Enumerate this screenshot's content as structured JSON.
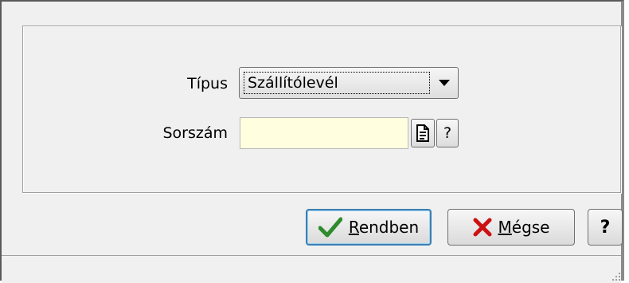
{
  "form": {
    "type_label": "Típus",
    "type_value": "Szállítólevél",
    "serial_label": "Sorszám",
    "serial_value": "",
    "serial_help": "?"
  },
  "buttons": {
    "ok_pre": "",
    "ok_mnemonic": "R",
    "ok_rest": "endben",
    "cancel_mnemonic": "M",
    "cancel_rest": "égse",
    "help": "?"
  },
  "colors": {
    "input_bg": "#ffffe0",
    "ok_border": "#3c7fb1",
    "check_green": "#2e8b2e",
    "cross_red": "#cc1111"
  },
  "icons": {
    "dropdown": "chevron-down-icon",
    "doc": "document-icon",
    "ok": "check-icon",
    "cancel": "cross-icon",
    "resize": "resize-grip-icon"
  }
}
